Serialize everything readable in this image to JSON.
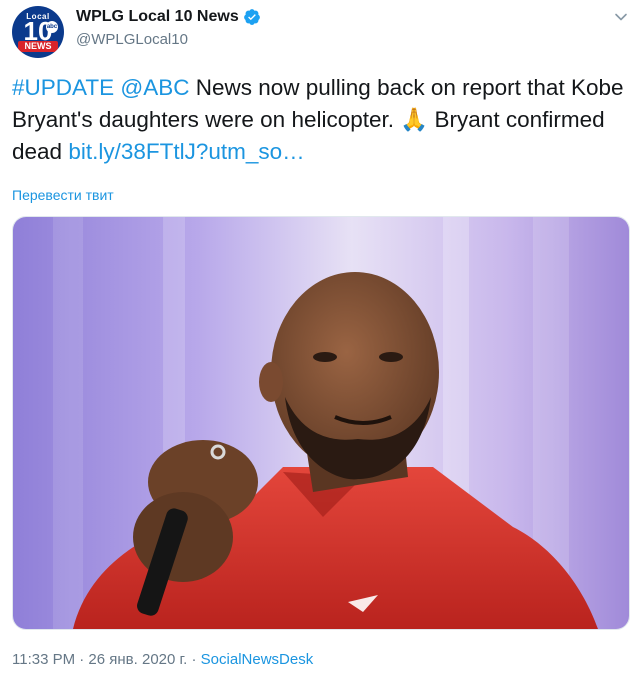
{
  "account": {
    "display_name": "WPLG Local 10 News",
    "handle": "@WPLGLocal10",
    "avatar_logo": {
      "top": "Local",
      "number": "10",
      "badge": "abc",
      "bottom": "NEWS"
    }
  },
  "tweet": {
    "text_parts": {
      "hashtag": "#UPDATE",
      "mention": "@ABC",
      "part1": " News now pulling back on report that Kobe Bryant's daughters were on helicopter. ",
      "emoji": "🙏",
      "part2": " Bryant confirmed dead ",
      "link": "bit.ly/38FTtlJ?utm_so…"
    },
    "translate_label": "Перевести твит",
    "photo_description_icon": "photo"
  },
  "footer": {
    "timestamp": "11:33 PM · 26 янв. 2020 г.",
    "separator": " · ",
    "source": "SocialNewsDesk"
  },
  "colors": {
    "link": "#1b95e0",
    "text": "#14171a",
    "secondary": "#657786",
    "verified": "#1da1f2"
  }
}
